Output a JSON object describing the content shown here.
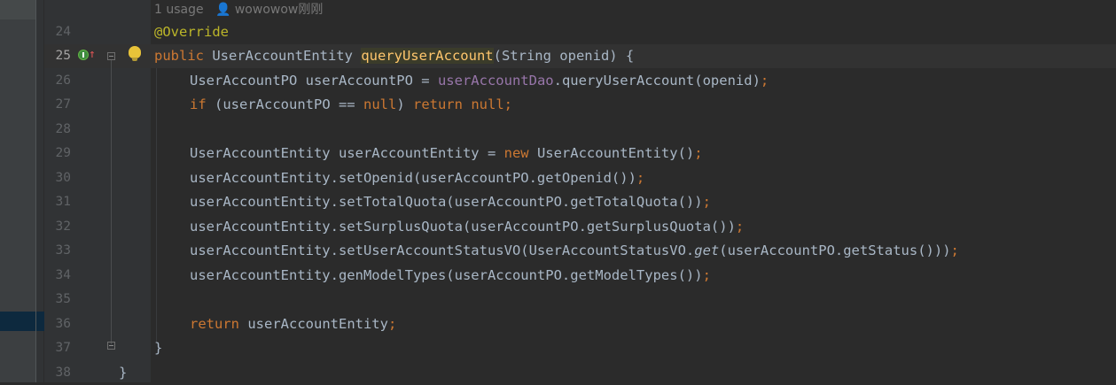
{
  "hint": {
    "usage": "1 usage",
    "author": "wowowow刚刚"
  },
  "icons": {
    "author": "person-icon",
    "implements": "implementation-marker-icon",
    "override_arrow": "override-up-arrow-icon",
    "intention": "lightbulb-icon",
    "fold": "fold-marker-icon"
  },
  "colors": {
    "background": "#2b2b2b",
    "keyword": "#cc7832",
    "annotation": "#bbb529",
    "field": "#9876aa",
    "method_decl": "#ffc66d",
    "text": "#a9b7c6",
    "line_number": "#606366"
  },
  "lines": [
    {
      "n": "24"
    },
    {
      "n": "25"
    },
    {
      "n": "26"
    },
    {
      "n": "27"
    },
    {
      "n": "28"
    },
    {
      "n": "29"
    },
    {
      "n": "30"
    },
    {
      "n": "31"
    },
    {
      "n": "32"
    },
    {
      "n": "33"
    },
    {
      "n": "34"
    },
    {
      "n": "35"
    },
    {
      "n": "36"
    },
    {
      "n": "37"
    },
    {
      "n": "38"
    }
  ],
  "code": {
    "l24": {
      "ann": "@Override"
    },
    "l25": {
      "kw": "public",
      "type": " UserAccountEntity ",
      "method": "queryUserAccount",
      "params": "(String openid) {"
    },
    "l26": {
      "a": "UserAccountPO userAccountPO = ",
      "field": "userAccountDao",
      "b": ".queryUserAccount(openid)",
      "semi": ";"
    },
    "l27": {
      "kw1": "if",
      "a": " (userAccountPO == ",
      "kw2": "null",
      "b": ") ",
      "kw3": "return",
      "c": " ",
      "kw4": "null",
      "semi": ";"
    },
    "l29": {
      "a": "UserAccountEntity userAccountEntity = ",
      "kw": "new",
      "b": " UserAccountEntity()",
      "semi": ";"
    },
    "l30": {
      "a": "userAccountEntity.setOpenid(userAccountPO.getOpenid())",
      "semi": ";"
    },
    "l31": {
      "a": "userAccountEntity.setTotalQuota(userAccountPO.getTotalQuota())",
      "semi": ";"
    },
    "l32": {
      "a": "userAccountEntity.setSurplusQuota(userAccountPO.getSurplusQuota())",
      "semi": ";"
    },
    "l33": {
      "a": "userAccountEntity.setUserAccountStatusVO(UserAccountStatusVO.",
      "it": "get",
      "b": "(userAccountPO.getStatus()))",
      "semi": ";"
    },
    "l34": {
      "a": "userAccountEntity.genModelTypes(userAccountPO.getModelTypes())",
      "semi": ";"
    },
    "l36": {
      "kw": "return",
      "a": " userAccountEntity",
      "semi": ";"
    },
    "l37": {
      "a": "}"
    },
    "l38": {
      "a": "}"
    }
  }
}
